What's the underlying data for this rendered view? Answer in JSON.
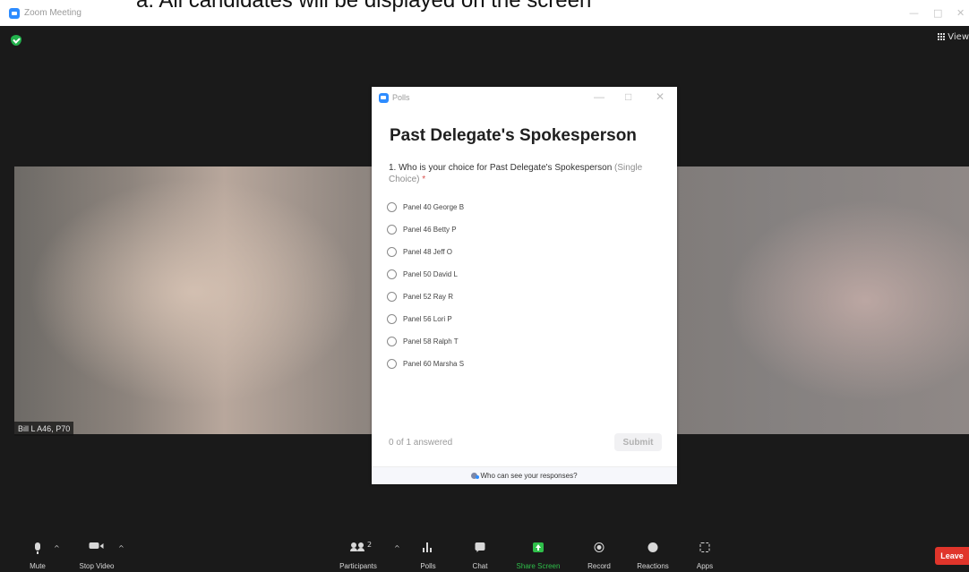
{
  "window": {
    "title": "Zoom Meeting",
    "overlay_caption": "a.  All candidates will be displayed on the screen",
    "controls": [
      "—",
      "□",
      "✕"
    ]
  },
  "meeting": {
    "view_label": "View",
    "participant_name": "Bill L  A46, P70"
  },
  "poll": {
    "window_title": "Polls",
    "window_controls": [
      "—",
      "□",
      "✕"
    ],
    "heading": "Past Delegate's Spokesperson",
    "question": "1. Who is your choice for Past Delegate's Spokesperson",
    "question_hint": "(Single Choice)",
    "required_marker": "*",
    "options": [
      "Panel 40 George B",
      "Panel 46 Betty P",
      "Panel 48 Jeff O",
      "Panel 50 David L",
      "Panel 52 Ray R",
      "Panel 56 Lori P",
      "Panel 58 Ralph T",
      "Panel 60 Marsha S"
    ],
    "answered_status": "0 of 1 answered",
    "submit_label": "Submit",
    "footer_link": "Who can see your responses?"
  },
  "toolbar": {
    "mute_label": "Mute",
    "stop_video_label": "Stop Video",
    "participants_label": "Participants",
    "participants_count": "2",
    "polls_label": "Polls",
    "chat_label": "Chat",
    "share_screen_label": "Share Screen",
    "record_label": "Record",
    "reactions_label": "Reactions",
    "apps_label": "Apps",
    "leave_label": "Leave",
    "caret": "^"
  },
  "colors": {
    "accent": "#2d8cff",
    "share_green": "#2fbf4a",
    "leave_red": "#e0352b",
    "background": "#1a1a1a"
  }
}
